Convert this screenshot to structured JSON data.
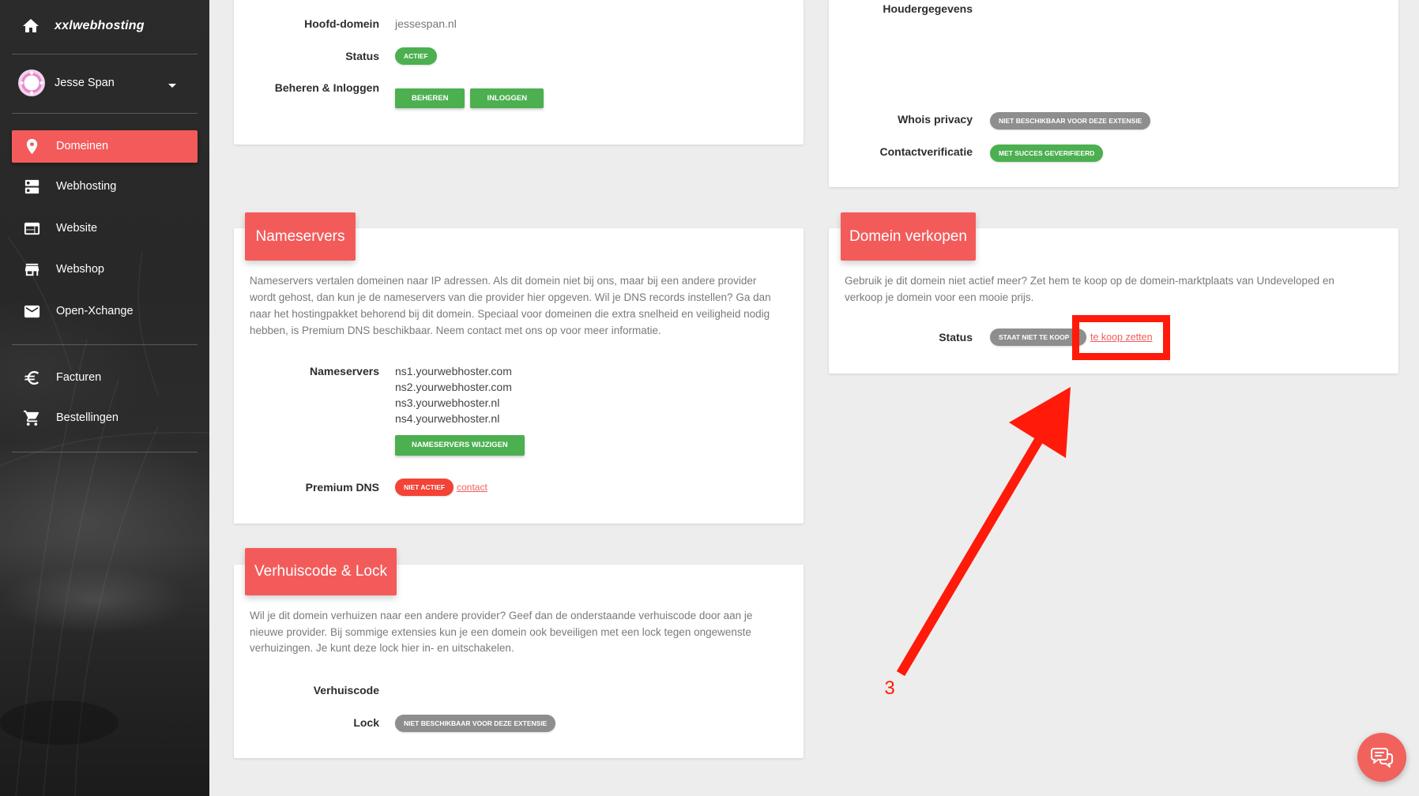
{
  "colors": {
    "accent": "#f35b5b",
    "success": "#4caf50",
    "neutral": "#8e8e8e",
    "danger": "#f44336",
    "annot": "#ff1a0a",
    "chat": "#f2625c",
    "page-bg": "#ededed"
  },
  "sidebar": {
    "logo": "xxlwebhosting",
    "logo_icon": "home-icon",
    "user": {
      "name": "Jesse Span",
      "menu_icon": "caret-down-icon"
    },
    "menu": [
      {
        "label": "Domeinen",
        "icon": "map-pin-icon",
        "active": true
      },
      {
        "label": "Webhosting",
        "icon": "server-icon",
        "active": false
      },
      {
        "label": "Website",
        "icon": "website-icon",
        "active": false
      },
      {
        "label": "Webshop",
        "icon": "store-icon",
        "active": false
      },
      {
        "label": "Open-Xchange",
        "icon": "mail-icon",
        "active": false
      }
    ],
    "menu_secondary": [
      {
        "label": "Facturen",
        "icon": "euro-icon"
      },
      {
        "label": "Bestellingen",
        "icon": "cart-icon"
      }
    ]
  },
  "domain_info": {
    "main_domain_label": "Hoofd-domein",
    "main_domain_value": "jessespan.nl",
    "status_label": "Status",
    "status_badge": "ACTIEF",
    "manage_label": "Beheren & Inloggen",
    "manage_button": "BEHEREN",
    "login_button": "INLOGGEN"
  },
  "owner": {
    "holder_label": "Houdergegevens",
    "whois_label": "Whois privacy",
    "whois_badge": "NIET BESCHIKBAAR VOOR DEZE EXTENSIE",
    "contact_label": "Contactverificatie",
    "contact_badge": "MET SUCCES GEVERIFIEERD"
  },
  "nameservers": {
    "title": "Nameservers",
    "description_lines": [
      "Nameservers vertalen domeinen naar IP adressen. Als dit domein niet bij ons, maar bij een andere provider",
      "wordt gehost, dan kun je de nameservers van die provider hier opgeven. Wil je DNS records instellen? Ga dan",
      "naar het hostingpakket behorend bij dit domein. Speciaal voor domeinen die extra snelheid en veiligheid nodig",
      "hebben, is Premium DNS beschikbaar. Neem contact met ons op voor meer informatie."
    ],
    "ns_label": "Nameservers",
    "ns_list": [
      "ns1.yourwebhoster.com",
      "ns2.yourwebhoster.com",
      "ns3.yourwebhoster.nl",
      "ns4.yourwebhoster.nl"
    ],
    "change_button": "NAMESERVERS WIJZIGEN",
    "premium_label": "Premium DNS",
    "premium_badge": "NIET ACTIEF",
    "contact_link": "contact"
  },
  "transfer": {
    "title": "Verhuiscode & Lock",
    "description_lines": [
      "Wil je dit domein verhuizen naar een andere provider? Geef dan de onderstaande verhuiscode door aan je",
      "nieuwe provider. Bij sommige extensies kun je een domein ook beveiligen met een lock tegen ongewenste",
      "verhuizingen. Je kunt deze lock hier in- en uitschakelen."
    ],
    "code_label": "Verhuiscode",
    "lock_label": "Lock",
    "lock_badge": "NIET BESCHIKBAAR VOOR DEZE EXTENSIE"
  },
  "sell": {
    "title": "Domein verkopen",
    "description_lines": [
      "Gebruik je dit domein niet actief meer? Zet hem te koop op de domein-marktplaats van Undeveloped en",
      "verkoop je domein voor een mooie prijs."
    ],
    "status_label": "Status",
    "status_badge": "STAAT NIET TE KOOP",
    "sell_link": "te koop zetten"
  },
  "annotation": {
    "step_label": "3"
  },
  "chat": {
    "icon": "chat-icon"
  }
}
